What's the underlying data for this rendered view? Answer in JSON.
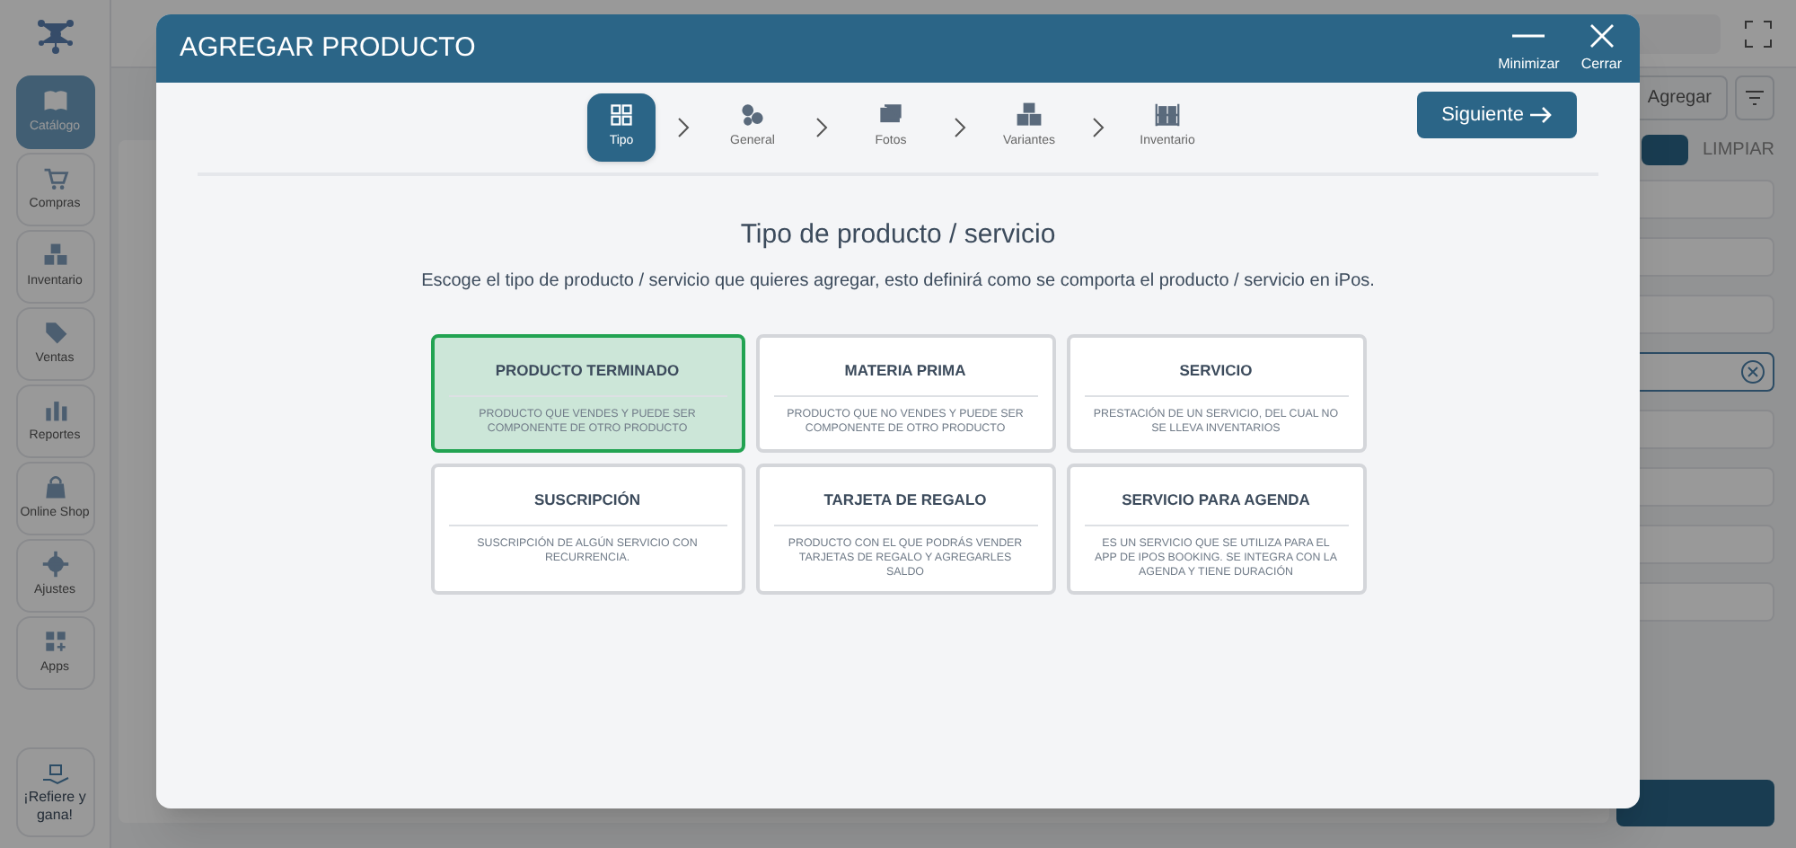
{
  "app": {
    "sidebar": [
      {
        "label": "Catálogo",
        "selected": true
      },
      {
        "label": "Compras",
        "selected": false
      },
      {
        "label": "Inventario",
        "selected": false
      },
      {
        "label": "Ventas",
        "selected": false
      },
      {
        "label": "Reportes",
        "selected": false
      },
      {
        "label": "Online Shop",
        "selected": false
      },
      {
        "label": "Ajustes",
        "selected": false
      },
      {
        "label": "Apps",
        "selected": false
      }
    ],
    "refer_button": "¡Refiere y gana!",
    "add_button": "Agregar",
    "clear_button": "LIMPIAR"
  },
  "modal": {
    "title": "AGREGAR PRODUCTO",
    "window_buttons": [
      {
        "label": "Minimizar",
        "kind": "minimize"
      },
      {
        "label": "Cerrar",
        "kind": "close"
      }
    ],
    "steps": [
      {
        "label": "Tipo",
        "selected": true
      },
      {
        "label": "General",
        "selected": false
      },
      {
        "label": "Fotos",
        "selected": false
      },
      {
        "label": "Variantes",
        "selected": false
      },
      {
        "label": "Inventario",
        "selected": false
      }
    ],
    "next_button": "Siguiente",
    "heading": "Tipo de producto / servicio",
    "subheading": "Escoge el tipo de producto / servicio que quieres agregar, esto definirá como se comporta el producto / servicio en iPos.",
    "options": [
      {
        "title": "PRODUCTO TERMINADO",
        "description": "PRODUCTO QUE VENDES Y PUEDE SER COMPONENTE DE OTRO PRODUCTO",
        "selected": true
      },
      {
        "title": "MATERIA PRIMA",
        "description": "PRODUCTO QUE NO VENDES Y PUEDE SER COMPONENTE DE OTRO PRODUCTO",
        "selected": false
      },
      {
        "title": "SERVICIO",
        "description": "PRESTACIÓN DE UN SERVICIO, DEL CUAL NO SE LLEVA INVENTARIOS",
        "selected": false
      },
      {
        "title": "SUSCRIPCIÓN",
        "description": "SUSCRIPCIÓN DE ALGÚN SERVICIO CON RECURRENCIA.",
        "selected": false
      },
      {
        "title": "TARJETA DE REGALO",
        "description": "PRODUCTO CON EL QUE PODRÁS VENDER TARJETAS DE REGALO Y AGREGARLES SALDO",
        "selected": false
      },
      {
        "title": "SERVICIO PARA AGENDA",
        "description": "ES UN SERVICIO QUE SE UTILIZA PARA EL APP DE IPOS BOOKING. SE INTEGRA CON LA AGENDA Y TIENE DURACIÓN",
        "selected": false
      }
    ]
  }
}
